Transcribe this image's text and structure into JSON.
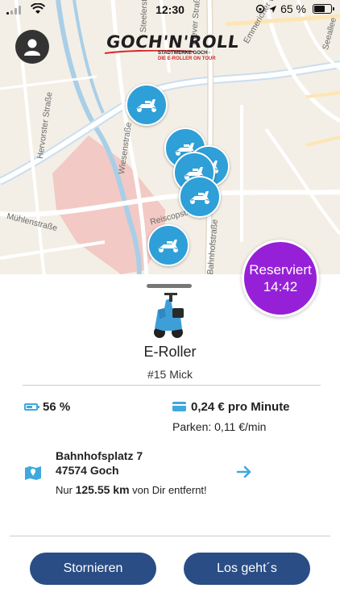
{
  "status_bar": {
    "time": "12:30",
    "battery_percent": "65 %"
  },
  "logo": {
    "brand": "GOCH'N'ROLL",
    "tagline_line1": "STADTWERKE GOCH -",
    "tagline_line2": "DIE E-ROLLER ON TOUR"
  },
  "map": {
    "streets": [
      "Hervorster Straße",
      "Wiesenstraße",
      "Mühlenstraße",
      "Reiscopstraße",
      "Bahnhofstraße",
      "Seeallee",
      "Emmericher Weg",
      "Klever Straße",
      "Steelerstraße"
    ],
    "markers_icon": "scooter-icon"
  },
  "reservation": {
    "label": "Reserviert",
    "countdown": "14:42"
  },
  "vehicle": {
    "type": "E-Roller",
    "id_label": "#15 Mick",
    "battery": "56 %",
    "battery_level": 0.56
  },
  "pricing": {
    "price": "0,24 € pro Minute",
    "parking": "Parken: 0,11 €/min"
  },
  "location": {
    "street": "Bahnhofsplatz 7",
    "city": "47574 Goch",
    "distance_prefix": "Nur",
    "distance_value": "125.55 km",
    "distance_suffix": "von Dir entfernt!"
  },
  "actions": {
    "cancel_label": "Stornieren",
    "go_label": "Los geht´s"
  },
  "colors": {
    "accent": "#2f9fd8",
    "button": "#2a4d86",
    "reserved": "#9620d7"
  }
}
